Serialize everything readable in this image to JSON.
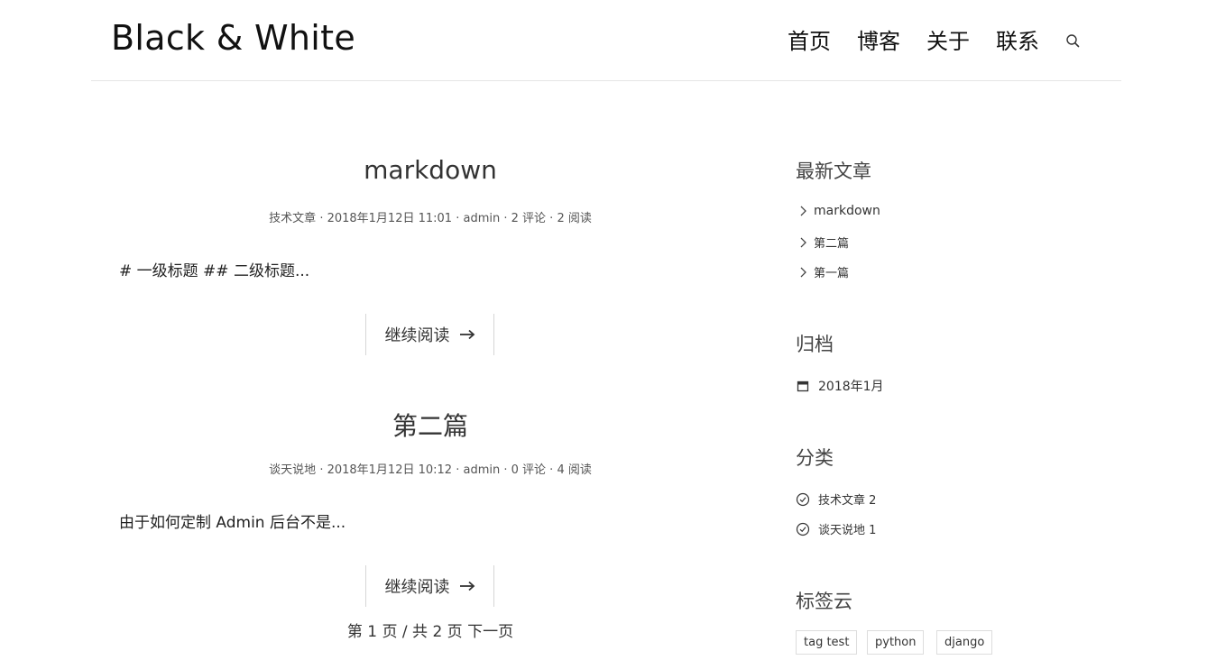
{
  "header": {
    "logo": "Black & White",
    "nav": [
      "首页",
      "博客",
      "关于",
      "联系"
    ],
    "search_icon": "search-icon"
  },
  "posts": [
    {
      "title": "markdown",
      "meta": {
        "category": "技术文章",
        "date": "2018年1月12日 11:01",
        "author": "admin",
        "comments": "2 评论",
        "views": "2 阅读"
      },
      "excerpt": "# 一级标题 ## 二级标题...",
      "read_more": "继续阅读"
    },
    {
      "title": "第二篇",
      "meta": {
        "category": "谈天说地",
        "date": "2018年1月12日 10:12",
        "author": "admin",
        "comments": "0 评论",
        "views": "4 阅读"
      },
      "excerpt": "由于如何定制 Admin 后台不是...",
      "read_more": "继续阅读"
    }
  ],
  "pagination": {
    "status": "第 1 页 / 共 2 页",
    "next": "下一页"
  },
  "sidebar": {
    "recent": {
      "title": "最新文章",
      "items": [
        "markdown",
        "第二篇",
        "第一篇"
      ]
    },
    "archive": {
      "title": "归档",
      "items": [
        "2018年1月"
      ]
    },
    "categories": {
      "title": "分类",
      "items": [
        "技术文章 2",
        "谈天说地 1"
      ]
    },
    "tags": {
      "title": "标签云",
      "items": [
        "tag test",
        "python",
        "django"
      ]
    }
  },
  "colors": {
    "text": "#333333",
    "border": "#e6e6e6",
    "background": "#ffffff"
  }
}
